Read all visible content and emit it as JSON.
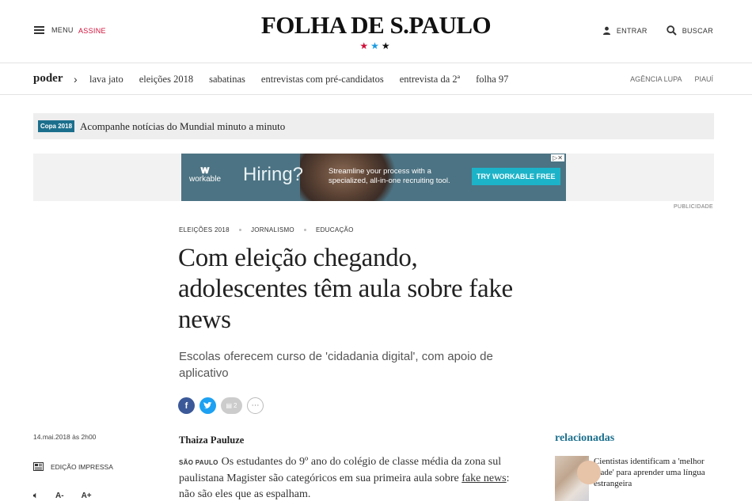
{
  "header": {
    "menu_label": "MENU",
    "assine_label": "ASSINE",
    "logo": "FOLHA DE S.PAULO",
    "stars": [
      "★",
      "★",
      "★"
    ],
    "entrar_label": "ENTRAR",
    "buscar_label": "BUSCAR"
  },
  "section_nav": {
    "title": "poder",
    "links": [
      "lava jato",
      "eleições 2018",
      "sabatinas",
      "entrevistas com pré-candidatos",
      "entrevista da 2ª",
      "folha 97"
    ],
    "right_links": [
      "AGÊNCIA LUPA",
      "PIAUÍ"
    ]
  },
  "copa": {
    "badge": "Copa 2018",
    "text": "Acompanhe notícias do Mundial minuto a minuto"
  },
  "ad": {
    "logo": "workable",
    "headline": "Hiring?",
    "copy": "Streamline your process with a specialized, all-in-one recruiting tool.",
    "cta": "TRY WORKABLE FREE",
    "publicidade": "PUBLICIDADE"
  },
  "article": {
    "tags": [
      "ELEIÇÕES 2018",
      "JORNALISMO",
      "EDUCAÇÃO"
    ],
    "headline": "Com eleição chegando, adolescentes têm aula sobre fake news",
    "subhead": "Escolas oferecem curso de 'cidadania digital', com apoio de aplicativo",
    "comment_count": "2",
    "date": "14.mai.2018 às 2h00",
    "print_edition": "EDIÇÃO IMPRESSA",
    "font_smaller": "A-",
    "font_larger": "A+",
    "author": "Thaiza Pauluze",
    "city": "SÃO PAULO",
    "body_start": "Os estudantes do 9º ano do colégio de classe média da zona sul paulistana Magister são categóricos em sua primeira aula sobre ",
    "body_link": "fake news",
    "body_end": ": não são eles que as espalham."
  },
  "related": {
    "title": "relacionadas",
    "items": [
      {
        "text": "Cientistas identificam a 'melhor idade' para aprender uma língua estrangeira"
      }
    ]
  },
  "colors": {
    "accent_red": "#d0103a",
    "accent_blue": "#1c9be0",
    "teal": "#1b6f8d"
  }
}
